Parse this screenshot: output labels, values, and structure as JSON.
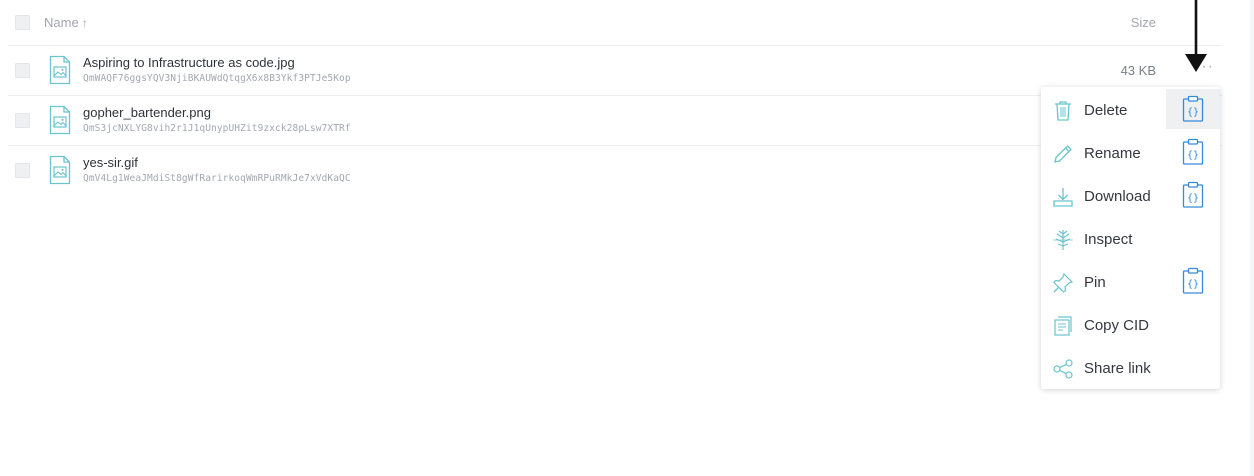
{
  "header": {
    "name_label": "Name",
    "sort_arrow": "↑",
    "size_label": "Size"
  },
  "files": [
    {
      "name": "Aspiring to Infrastructure as code.jpg",
      "cid": "QmWAQF76ggsYQV3NjiBKAUWdQtqgX6x8B3Ykf3PTJe5Kop",
      "size": "43 KB",
      "icon": "image-file-icon"
    },
    {
      "name": "gopher_bartender.png",
      "cid": "QmS3jcNXLYG8vih2r1J1qUnypUHZit9zxck28pLsw7XTRf",
      "size": "",
      "icon": "image-file-icon"
    },
    {
      "name": "yes-sir.gif",
      "cid": "QmV4Lg1WeaJMdiSt8gWfRarirkoqWmRPuRMkJe7xVdKaQC",
      "size": "",
      "icon": "image-file-icon"
    }
  ],
  "more_label": "···",
  "context_menu": {
    "items": [
      {
        "label": "Delete",
        "icon": "trash-icon",
        "api": true,
        "active": true
      },
      {
        "label": "Rename",
        "icon": "pencil-icon",
        "api": true,
        "active": false
      },
      {
        "label": "Download",
        "icon": "download-icon",
        "api": true,
        "active": false
      },
      {
        "label": "Inspect",
        "icon": "inspect-icon",
        "api": false,
        "active": false
      },
      {
        "label": "Pin",
        "icon": "pin-icon",
        "api": true,
        "active": false
      },
      {
        "label": "Copy CID",
        "icon": "copy-icon",
        "api": false,
        "active": false
      },
      {
        "label": "Share link",
        "icon": "share-icon",
        "api": false,
        "active": false
      }
    ]
  },
  "colors": {
    "accent_teal": "#69c4cd",
    "api_blue": "#378ad8",
    "text": "#34373f",
    "muted": "#a4a7ad"
  }
}
